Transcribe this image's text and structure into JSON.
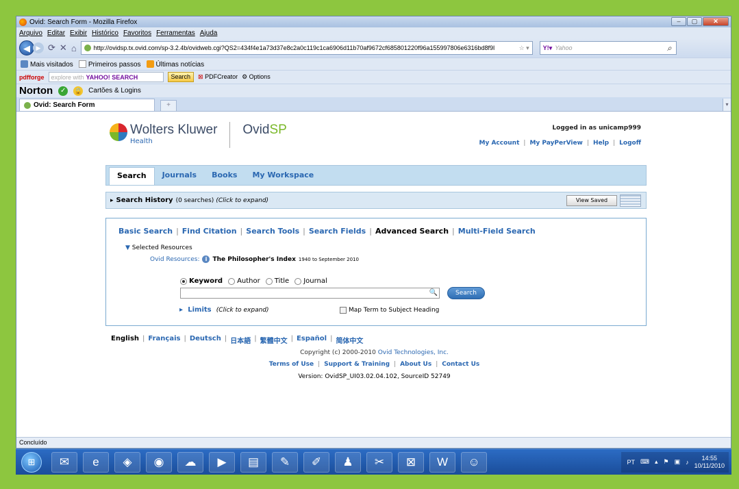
{
  "window": {
    "title": "Ovid: Search Form - Mozilla Firefox"
  },
  "menu": [
    "Arquivo",
    "Editar",
    "Exibir",
    "Histórico",
    "Favoritos",
    "Ferramentas",
    "Ajuda"
  ],
  "nav": {
    "url": "http://ovidsp.tx.ovid.com/sp-3.2.4b/ovidweb.cgi?QS2=434f4e1a73d37e8c2a0c119c1ca6906d11b70af9672cf685801220f96a155997806e6316bd8f9l",
    "search_placeholder": "Yahoo"
  },
  "bookmarks": [
    "Mais visitados",
    "Primeiros passos",
    "Últimas notícias"
  ],
  "toolbar2": {
    "pdfforge": "pdfforge",
    "yahoo_placeholder": "explore with",
    "yahoo_logo": "YAHOO! SEARCH",
    "search_btn": "Search",
    "pdfcreator": "PDFCreator",
    "options": "Options"
  },
  "norton": {
    "logo": "Norton",
    "cartoes": "Cartões & Logins"
  },
  "tab": {
    "label": "Ovid: Search Form",
    "newtab": "+"
  },
  "header": {
    "brand": "Wolters Kluwer",
    "health": "Health",
    "product_pre": "Ovid",
    "product_post": "SP",
    "logged": "Logged in as unicamp999",
    "links": [
      "My Account",
      "My PayPerView",
      "Help",
      "Logoff"
    ]
  },
  "mainnav": [
    "Search",
    "Journals",
    "Books",
    "My Workspace"
  ],
  "history": {
    "label": "Search History",
    "count": "(0 searches)",
    "hint": "(Click to expand)",
    "view_saved": "View Saved"
  },
  "search": {
    "tabs": [
      "Basic Search",
      "Find Citation",
      "Search Tools",
      "Search Fields",
      "Advanced Search",
      "Multi-Field Search"
    ],
    "selected_resources": "Selected Resources",
    "ovid_resources_label": "Ovid Resources:",
    "resource_name": "The Philosopher's Index",
    "resource_range": "1940 to September 2010",
    "options": [
      "Keyword",
      "Author",
      "Title",
      "Journal"
    ],
    "button": "Search",
    "limits": "Limits",
    "limits_hint": "(Click to expand)",
    "map_term": "Map Term to Subject Heading"
  },
  "languages": [
    "English",
    "Français",
    "Deutsch",
    "日本語",
    "繁體中文",
    "Español",
    "简体中文"
  ],
  "footer": {
    "copyright_pre": "Copyright (c) 2000-2010",
    "copyright_link": "Ovid Technologies, Inc.",
    "links": [
      "Terms of Use",
      "Support & Training",
      "About Us",
      "Contact Us"
    ],
    "version": "Version: OvidSP_UI03.02.04.102, SourceID 52749"
  },
  "status": "Concluído",
  "taskbar": {
    "lang": "PT",
    "time": "14:55",
    "date": "10/11/2010"
  }
}
